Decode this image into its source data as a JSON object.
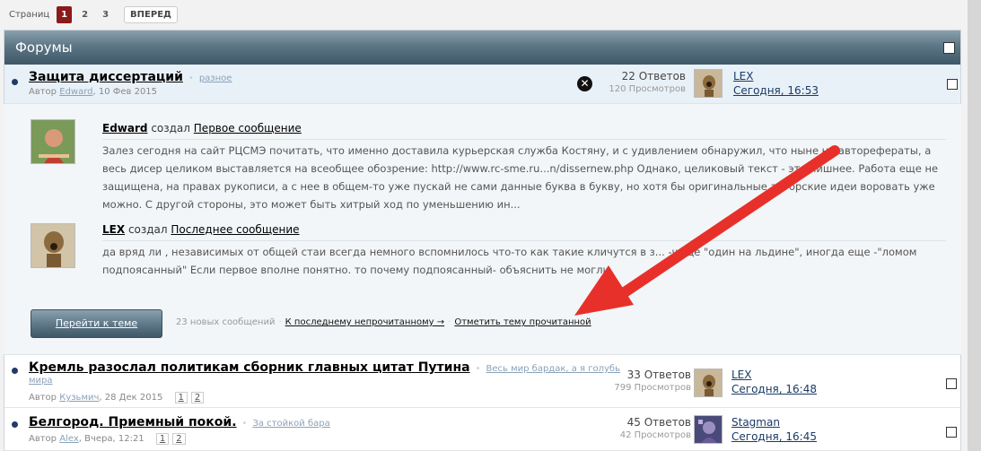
{
  "pagenav": {
    "label": "Страниц",
    "pages": [
      "1",
      "2",
      "3"
    ],
    "current": "1",
    "next": "ВПЕРЕД"
  },
  "forum": {
    "title": "Форумы"
  },
  "threads": [
    {
      "title": "Защита диссертаций",
      "tag": "разное",
      "author_prefix": "Автор",
      "author": "Edward",
      "date": "10 Фев 2015",
      "replies": "22 Ответов",
      "views": "120 Просмотров",
      "last_user": "LEX",
      "last_time": "Сегодня, 16:53"
    },
    {
      "title": "Кремль разослал политикам сборник главных цитат Путина",
      "tag_line1": "Весь мир бардак, а я голубь",
      "tag_line2": "мира",
      "author_prefix": "Автор",
      "author": "Кузьмич",
      "date": "28 Дек 2015",
      "pages": [
        "1",
        "2"
      ],
      "replies": "33 Ответов",
      "views": "799 Просмотров",
      "last_user": "LEX",
      "last_time": "Сегодня, 16:48"
    },
    {
      "title": "Белгород. Приемный покой.",
      "tag": "За стойкой бара",
      "author_prefix": "Автор",
      "author": "Alex",
      "date": "Вчера, 12:21",
      "pages": [
        "1",
        "2"
      ],
      "replies": "45 Ответов",
      "views": "42 Просмотров",
      "last_user": "Stagman",
      "last_time": "Сегодня, 16:45"
    }
  ],
  "preview": {
    "first": {
      "user": "Edward",
      "verb": "создал",
      "link": "Первое сообщение",
      "text": "Залез сегодня на сайт РЦСМЭ почитать, что именно доставила курьерская служба Костяну, и с удивлением обнаружил, что ныне не автореферат﻿ы, а весь дисер целиком выставляется на всеобщее обозрение: http://www.rc-sme.ru...n/dissernew.php Однако, целиковый текст - это лишнее. Работа еще не защищена, на правах рукописи, а с нее в общем-то уже пускай не сами данные буква в букву, но хотя бы оригинальные авторские идеи воровать уже можно. С другой стороны, это может быть хитрый ход по уменьшению ин..."
    },
    "last": {
      "user": "LEX",
      "verb": "создал",
      "link": "Последнее сообщение",
      "text": "да вряд ли , независимых от общей стаи всегда немного вспомнилось что-то как такие кличутся в з... -чаще \"один на льдине\", иногда еще -\"ломом подпоясанный\" Если первое вполне понятно. то почему подпоясанный- объяснить не могли"
    },
    "goto_button": "Перейти к теме",
    "new_count": "23 новых сообщений",
    "to_unread": "К последнему непрочитанному →",
    "mark_read": "Отметить тему прочитанной"
  },
  "colors": {
    "header_grad_top": "#8aa0ae",
    "header_grad_bottom": "#3f5868",
    "current_page": "#8b1a1a",
    "arrow": "#e8302a"
  }
}
